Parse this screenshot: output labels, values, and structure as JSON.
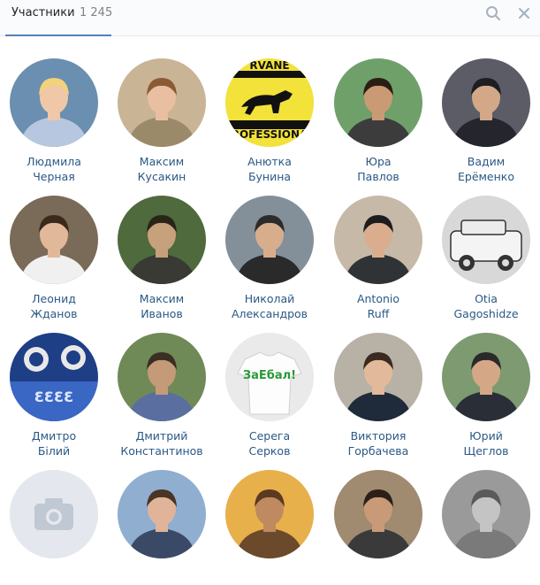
{
  "header": {
    "tab_label": "Участники",
    "tab_count": "1 245",
    "search_icon": "search-icon",
    "close_icon": "close-icon"
  },
  "members": [
    {
      "first": "Людмила",
      "last": "Черная",
      "bg": "#6a8fb0",
      "skin": "#f0c8a8",
      "hair": "#f2d27a",
      "shirt": "#b6c7df"
    },
    {
      "first": "Максим",
      "last": "Кусакин",
      "bg": "#c9b496",
      "skin": "#e8bfa0",
      "hair": "#8a5a34",
      "shirt": "#9b8a6a"
    },
    {
      "first": "Анютка",
      "last": "Бунина",
      "bg": "#f2e23a",
      "skin": "#111111",
      "hair": "#111111",
      "shirt": "#f2e23a",
      "logo": true,
      "logo_top": "RVANE",
      "logo_bottom": "ROFESSIONA"
    },
    {
      "first": "Юра",
      "last": "Павлов",
      "bg": "#6fa06a",
      "skin": "#c99a74",
      "hair": "#2a1e14",
      "shirt": "#3c3c3c"
    },
    {
      "first": "Вадим",
      "last": "Ерёменко",
      "bg": "#5b5c66",
      "skin": "#d2a888",
      "hair": "#1e1e22",
      "shirt": "#25252d"
    },
    {
      "first": "Леонид",
      "last": "Жданов",
      "bg": "#7a6a58",
      "skin": "#e1b89a",
      "hair": "#3a2a1c",
      "shirt": "#f0f0f0"
    },
    {
      "first": "Максим",
      "last": "Иванов",
      "bg": "#4f6a3c",
      "skin": "#c7a07c",
      "hair": "#2a2418",
      "shirt": "#3a3a34"
    },
    {
      "first": "Николай",
      "last": "Александров",
      "bg": "#83909a",
      "skin": "#d8ad8c",
      "hair": "#2b2b2b",
      "shirt": "#2a2a2a"
    },
    {
      "first": "Antonio",
      "last": "Ruff",
      "bg": "#c7b9a8",
      "skin": "#d9ad8e",
      "hair": "#1d1d1d",
      "shirt": "#2f3336"
    },
    {
      "first": "Otia",
      "last": "Gagoshidze",
      "bg": "#d8d8d8",
      "skin": "#8a8a8a",
      "hair": "#3a3a3a",
      "shirt": "#5a5a5a",
      "car": true
    },
    {
      "first": "Дмитро",
      "last": "Білий",
      "bg": "#1e3e86",
      "skin": "#e8e8e8",
      "hair": "#1e3e86",
      "shirt": "#3a66c4",
      "emblem": true
    },
    {
      "first": "Дмитрий",
      "last": "Константинов",
      "bg": "#6f8a56",
      "skin": "#c59a78",
      "hair": "#3b2e22",
      "shirt": "#5a6fa0"
    },
    {
      "first": "Серега",
      "last": "Серков",
      "bg": "#eaeaea",
      "skin": "#ffffff",
      "hair": "#ffffff",
      "shirt": "#ffffff",
      "tshirt": true,
      "tshirt_text": "ЗаЕбал!"
    },
    {
      "first": "Виктория",
      "last": "Горбачева",
      "bg": "#b8b2a6",
      "skin": "#e2b99a",
      "hair": "#3a2a20",
      "shirt": "#1f2a3a"
    },
    {
      "first": "Юрий",
      "last": "Щеглов",
      "bg": "#7d9a70",
      "skin": "#d4a886",
      "hair": "#2a2a2a",
      "shirt": "#2a2e36"
    },
    {
      "first": "",
      "last": "",
      "bg": "#e4e8ee",
      "skin": "#bfc8d3",
      "hair": "#bfc8d3",
      "shirt": "#bfc8d3",
      "camera": true
    },
    {
      "first": "",
      "last": "",
      "bg": "#8faed0",
      "skin": "#e0b498",
      "hair": "#4a3424",
      "shirt": "#3a4a66"
    },
    {
      "first": "",
      "last": "",
      "bg": "#e8b04a",
      "skin": "#c08a60",
      "hair": "#5a3a20",
      "shirt": "#6a4a2a"
    },
    {
      "first": "",
      "last": "",
      "bg": "#a08a70",
      "skin": "#c99a78",
      "hair": "#2a2018",
      "shirt": "#3a3a3a"
    },
    {
      "first": "",
      "last": "",
      "bg": "#9a9a9a",
      "skin": "#c4c4c4",
      "hair": "#5a5a5a",
      "shirt": "#7a7a7a"
    }
  ]
}
